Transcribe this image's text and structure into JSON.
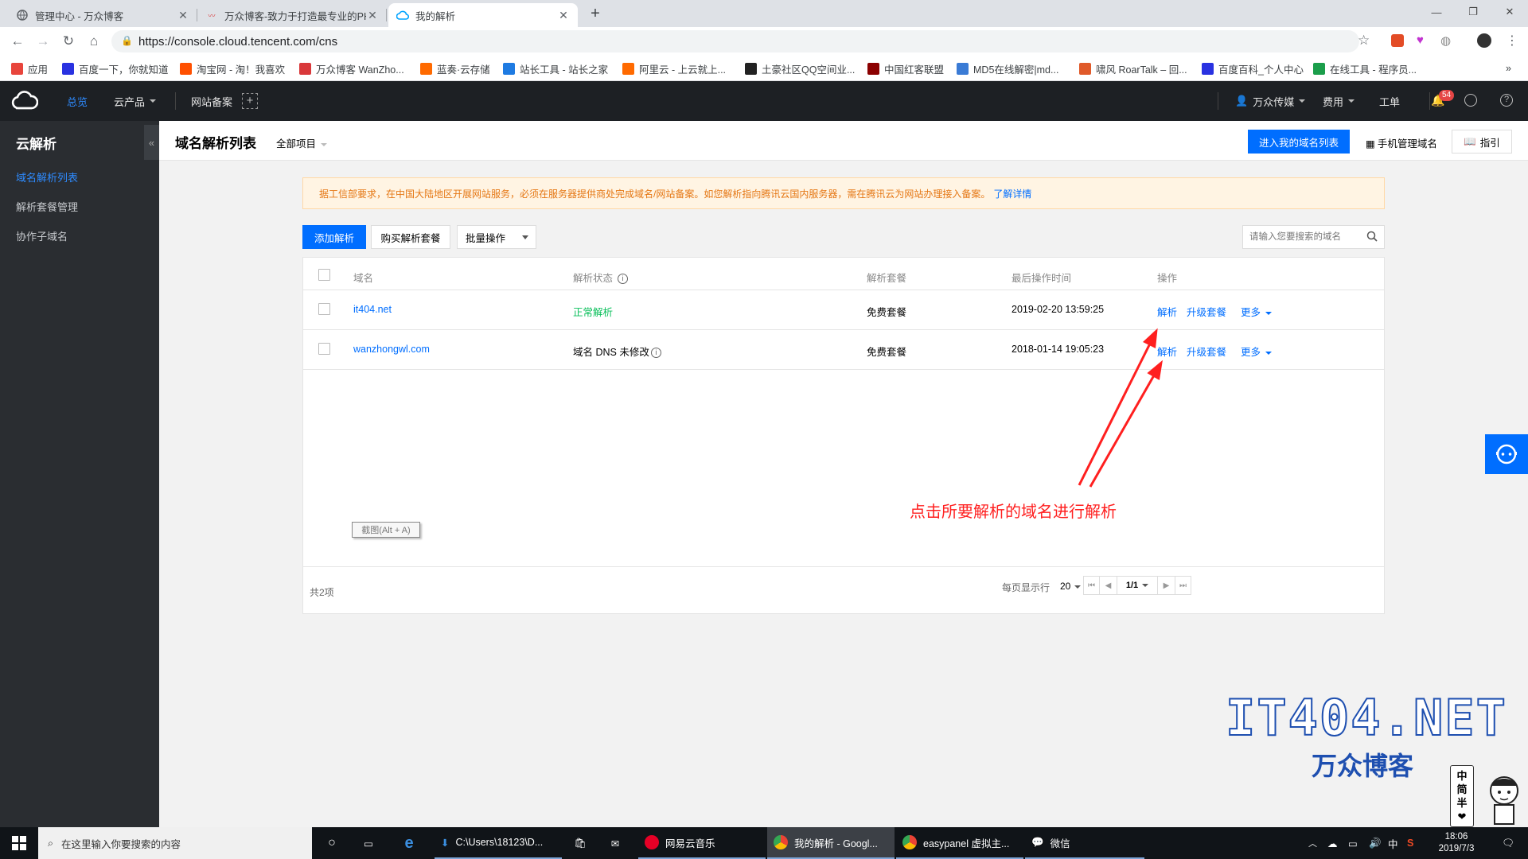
{
  "browser": {
    "tabs": [
      {
        "title": "管理中心 - 万众博客",
        "active": false
      },
      {
        "title": "万众博客-致力于打造最专业的PH",
        "active": false
      },
      {
        "title": "我的解析",
        "active": true
      }
    ],
    "new_tab": "+",
    "url": "https://console.cloud.tencent.com/cns",
    "bookmarks": [
      {
        "label": "应用",
        "color": "#e8453c"
      },
      {
        "label": "百度一下，你就知道",
        "color": "#2932e1"
      },
      {
        "label": "淘宝网 - 淘！我喜欢",
        "color": "#ff5000"
      },
      {
        "label": "万众博客 WanZho...",
        "color": "#d9383a"
      },
      {
        "label": "蓝奏·云存储",
        "color": "#ff6a00"
      },
      {
        "label": "站长工具 - 站长之家",
        "color": "#1e7be2"
      },
      {
        "label": "阿里云 - 上云就上...",
        "color": "#ff6a00"
      },
      {
        "label": "土豪社区QQ空间业...",
        "color": "#222222"
      },
      {
        "label": "中国红客联盟",
        "color": "#8b0000"
      },
      {
        "label": "MD5在线解密|md...",
        "color": "#3a7bd5"
      },
      {
        "label": "啸风 RoarTalk – 回...",
        "color": "#e05a2a"
      },
      {
        "label": "百度百科_个人中心",
        "color": "#2932e1"
      },
      {
        "label": "在线工具 - 程序员...",
        "color": "#1b9e4b"
      }
    ],
    "bookmarks_more": "»"
  },
  "topnav": {
    "overview": "总览",
    "products": "云产品",
    "icp": "网站备案",
    "account": "万众传媒",
    "billing": "费用",
    "ticket": "工单",
    "notification_count": "54"
  },
  "sidebar": {
    "title": "云解析",
    "collapse": "«",
    "items": [
      {
        "label": "域名解析列表",
        "active": true
      },
      {
        "label": "解析套餐管理",
        "active": false
      },
      {
        "label": "协作子域名",
        "active": false
      }
    ]
  },
  "header": {
    "title": "域名解析列表",
    "project_filter": "全部项目",
    "enter_domain_list": "进入我的域名列表",
    "mobile_manage": "手机管理域名",
    "guide": "指引"
  },
  "notice": {
    "text": "据工信部要求，在中国大陆地区开展网站服务，必须在服务器提供商处完成域名/网站备案。如您解析指向腾讯云国内服务器，需在腾讯云为网站办理接入备案。",
    "link": "了解详情"
  },
  "toolbar": {
    "add_record": "添加解析",
    "buy_plan": "购买解析套餐",
    "batch_ops": "批量操作",
    "search_placeholder": "请输入您要搜索的域名"
  },
  "table": {
    "columns": {
      "domain": "域名",
      "status": "解析状态",
      "plan": "解析套餐",
      "last_op_time": "最后操作时间",
      "actions": "操作"
    },
    "rows": [
      {
        "domain": "it404.net",
        "status": "正常解析",
        "plan": "免费套餐",
        "time": "2019-02-20 13:59:25",
        "resolve": "解析",
        "upgrade": "升级套餐",
        "more": "更多"
      },
      {
        "domain": "wanzhongwl.com",
        "status": "域名 DNS 未修改",
        "plan": "免费套餐",
        "time": "2018-01-14 19:05:23",
        "resolve": "解析",
        "upgrade": "升级套餐",
        "more": "更多"
      }
    ],
    "total": "共2项",
    "per_page_label": "每页显示行",
    "per_page": "20",
    "page": "1/1"
  },
  "overlay": {
    "screenshot_tooltip": "截图(Alt + A)",
    "annotation": "点击所要解析的域名进行解析",
    "watermark_en": "IT404.NET",
    "watermark_cn": "万众博客",
    "ime_chars": [
      "中",
      "简",
      "半",
      "❤"
    ]
  },
  "taskbar": {
    "search_placeholder": "在这里输入你要搜索的内容",
    "apps": [
      {
        "label": "C:\\Users\\18123\\D..."
      },
      {
        "label": "网易云音乐"
      },
      {
        "label": "我的解析 - Googl..."
      },
      {
        "label": "easypanel 虚拟主..."
      },
      {
        "label": "微信"
      }
    ],
    "ime": "中",
    "time": "18:06",
    "date": "2019/7/3"
  }
}
